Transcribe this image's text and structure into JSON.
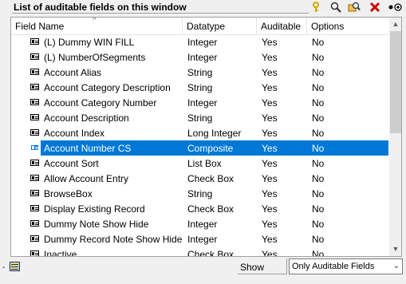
{
  "window": {
    "title": "List of auditable fields on this window"
  },
  "toolbar": {
    "icons": [
      "key-icon",
      "magnifier-icon",
      "find-icon",
      "delete-icon",
      "toggle-icon"
    ]
  },
  "list": {
    "columns": [
      "Field Name",
      "Datatype",
      "Auditable",
      "Options"
    ],
    "rows": [
      {
        "name": "(L) Dummy WIN FILL",
        "datatype": "Integer",
        "auditable": "Yes",
        "options": "No"
      },
      {
        "name": "(L) NumberOfSegments",
        "datatype": "Integer",
        "auditable": "Yes",
        "options": "No"
      },
      {
        "name": "Account Alias",
        "datatype": "String",
        "auditable": "Yes",
        "options": "No"
      },
      {
        "name": "Account Category Description",
        "datatype": "String",
        "auditable": "Yes",
        "options": "No"
      },
      {
        "name": "Account Category Number",
        "datatype": "Integer",
        "auditable": "Yes",
        "options": "No"
      },
      {
        "name": "Account Description",
        "datatype": "String",
        "auditable": "Yes",
        "options": "No"
      },
      {
        "name": "Account Index",
        "datatype": "Long Integer",
        "auditable": "Yes",
        "options": "No"
      },
      {
        "name": "Account Number CS",
        "datatype": "Composite",
        "auditable": "Yes",
        "options": "No",
        "selected": true
      },
      {
        "name": "Account Sort",
        "datatype": "List Box",
        "auditable": "Yes",
        "options": "No"
      },
      {
        "name": "Allow Account Entry",
        "datatype": "Check Box",
        "auditable": "Yes",
        "options": "No"
      },
      {
        "name": "BrowseBox",
        "datatype": "String",
        "auditable": "Yes",
        "options": "No"
      },
      {
        "name": "Display Existing Record",
        "datatype": "Check Box",
        "auditable": "Yes",
        "options": "No"
      },
      {
        "name": "Dummy Note Show Hide",
        "datatype": "Integer",
        "auditable": "Yes",
        "options": "No"
      },
      {
        "name": "Dummy Record Note Show Hide",
        "datatype": "Integer",
        "auditable": "Yes",
        "options": "No"
      },
      {
        "name": "Inactive",
        "datatype": "Check Box",
        "auditable": "Yes",
        "options": "No"
      }
    ]
  },
  "footer": {
    "dash": "-",
    "show_label": "Show",
    "filter_value": "Only Auditable Fields"
  },
  "colors": {
    "selection": "#0078d7",
    "key_icon": "#d4a400",
    "delete_icon": "#cc0000"
  }
}
